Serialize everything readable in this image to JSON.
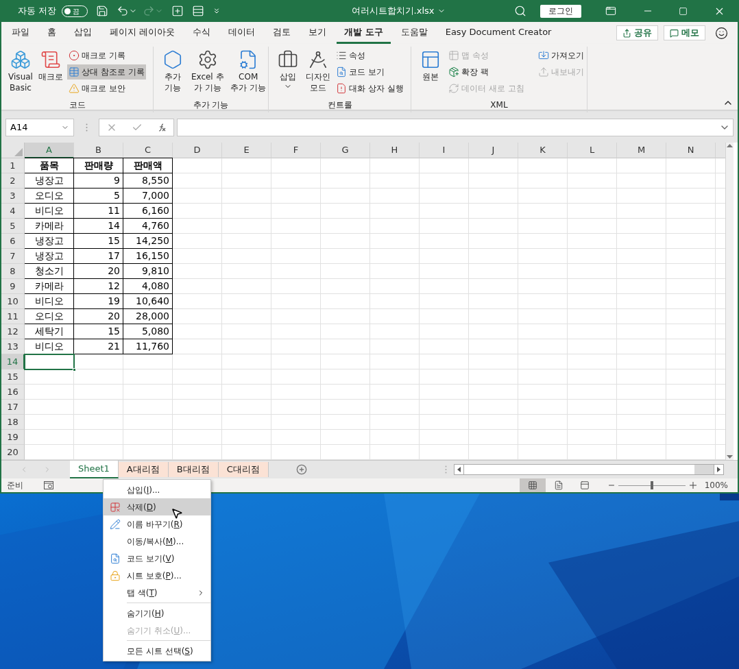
{
  "title_bar": {
    "autosave_label": "자동 저장",
    "autosave_on": false,
    "autosave_state": "끔",
    "document_title": "여러시트합치기.xlsx",
    "login": "로그인"
  },
  "ribbon_tabs": [
    {
      "label": "파일",
      "selected": false
    },
    {
      "label": "홈",
      "selected": false
    },
    {
      "label": "삽입",
      "selected": false
    },
    {
      "label": "페이지 레이아웃",
      "selected": false
    },
    {
      "label": "수식",
      "selected": false
    },
    {
      "label": "데이터",
      "selected": false
    },
    {
      "label": "검토",
      "selected": false
    },
    {
      "label": "보기",
      "selected": false
    },
    {
      "label": "개발 도구",
      "selected": true
    },
    {
      "label": "도움말",
      "selected": false
    },
    {
      "label": "Easy Document Creator",
      "selected": false
    }
  ],
  "share_button": "공유",
  "comments_button": "메모",
  "ribbon_groups": [
    {
      "label": "코드",
      "large": [
        {
          "label": "Visual\nBasic",
          "dropdown": false
        },
        {
          "label": "매크로",
          "dropdown": false
        }
      ],
      "small_columns": [
        [
          {
            "label": "매크로 기록",
            "disabled": false,
            "selected": false
          },
          {
            "label": "상대 참조로 기록",
            "disabled": false,
            "selected": true
          },
          {
            "label": "매크로 보안",
            "disabled": false,
            "selected": false
          }
        ]
      ]
    },
    {
      "label": "추가 기능",
      "large": [
        {
          "label": "추가\n기능",
          "dropdown": false
        },
        {
          "label": "Excel 추\n가 기능",
          "dropdown": false
        },
        {
          "label": "COM\n추가 기능",
          "dropdown": false
        }
      ]
    },
    {
      "label": "컨트롤",
      "large": [
        {
          "label": "삽입",
          "dropdown": true
        },
        {
          "label": "디자인\n모드",
          "dropdown": false
        }
      ],
      "small_columns": [
        [
          {
            "label": "속성",
            "disabled": false,
            "selected": false
          },
          {
            "label": "코드 보기",
            "disabled": false,
            "selected": false
          },
          {
            "label": "대화 상자 실행",
            "disabled": false,
            "selected": false
          }
        ]
      ]
    },
    {
      "label": "XML",
      "large": [
        {
          "label": "원본",
          "dropdown": false
        }
      ],
      "small_columns": [
        [
          {
            "label": "맵 속성",
            "disabled": true,
            "selected": false
          },
          {
            "label": "확장 팩",
            "disabled": false,
            "selected": false
          },
          {
            "label": "데이터 새로 고침",
            "disabled": true,
            "selected": false
          }
        ],
        [
          {
            "label": "가져오기",
            "disabled": false,
            "selected": false
          },
          {
            "label": "내보내기",
            "disabled": true,
            "selected": false
          }
        ]
      ]
    }
  ],
  "name_box": "A14",
  "columns": [
    {
      "label": "A",
      "selected": true
    },
    {
      "label": "B",
      "selected": false
    },
    {
      "label": "C",
      "selected": false
    },
    {
      "label": "D",
      "selected": false
    },
    {
      "label": "E",
      "selected": false
    },
    {
      "label": "F",
      "selected": false
    },
    {
      "label": "G",
      "selected": false
    },
    {
      "label": "H",
      "selected": false
    },
    {
      "label": "I",
      "selected": false
    },
    {
      "label": "J",
      "selected": false
    },
    {
      "label": "K",
      "selected": false
    },
    {
      "label": "L",
      "selected": false
    },
    {
      "label": "M",
      "selected": false
    },
    {
      "label": "N",
      "selected": false
    }
  ],
  "rows": [
    {
      "number": "1",
      "kind": "header",
      "selected": false,
      "cells": [
        "품목",
        "판매량",
        "판매액"
      ]
    },
    {
      "number": "2",
      "kind": "data",
      "selected": false,
      "cells": [
        "냉장고",
        "9",
        "8,550"
      ]
    },
    {
      "number": "3",
      "kind": "data",
      "selected": false,
      "cells": [
        "오디오",
        "5",
        "7,000"
      ]
    },
    {
      "number": "4",
      "kind": "data",
      "selected": false,
      "cells": [
        "비디오",
        "11",
        "6,160"
      ]
    },
    {
      "number": "5",
      "kind": "data",
      "selected": false,
      "cells": [
        "카메라",
        "14",
        "4,760"
      ]
    },
    {
      "number": "6",
      "kind": "data",
      "selected": false,
      "cells": [
        "냉장고",
        "15",
        "14,250"
      ]
    },
    {
      "number": "7",
      "kind": "data",
      "selected": false,
      "cells": [
        "냉장고",
        "17",
        "16,150"
      ]
    },
    {
      "number": "8",
      "kind": "data",
      "selected": false,
      "cells": [
        "청소기",
        "20",
        "9,810"
      ]
    },
    {
      "number": "9",
      "kind": "data",
      "selected": false,
      "cells": [
        "카메라",
        "12",
        "4,080"
      ]
    },
    {
      "number": "10",
      "kind": "data",
      "selected": false,
      "cells": [
        "비디오",
        "19",
        "10,640"
      ]
    },
    {
      "number": "11",
      "kind": "data",
      "selected": false,
      "cells": [
        "오디오",
        "20",
        "28,000"
      ]
    },
    {
      "number": "12",
      "kind": "data",
      "selected": false,
      "cells": [
        "세탁기",
        "15",
        "5,080"
      ]
    },
    {
      "number": "13",
      "kind": "data",
      "selected": false,
      "cells": [
        "비디오",
        "21",
        "11,760"
      ]
    },
    {
      "number": "14",
      "kind": "empty",
      "selected": true,
      "cells": []
    },
    {
      "number": "15",
      "kind": "empty",
      "selected": false,
      "cells": []
    },
    {
      "number": "16",
      "kind": "empty",
      "selected": false,
      "cells": []
    },
    {
      "number": "17",
      "kind": "empty",
      "selected": false,
      "cells": []
    },
    {
      "number": "18",
      "kind": "empty",
      "selected": false,
      "cells": []
    },
    {
      "number": "19",
      "kind": "empty",
      "selected": false,
      "cells": []
    },
    {
      "number": "20",
      "kind": "empty",
      "selected": false,
      "cells": []
    }
  ],
  "sheet_tabs": [
    {
      "label": "Sheet1",
      "selected": true
    },
    {
      "label": "A대리점",
      "selected": false,
      "color": "#fbe2d5"
    },
    {
      "label": "B대리점",
      "selected": false,
      "color": "#fbe2d5"
    },
    {
      "label": "C대리점",
      "selected": false,
      "color": "#fbe2d5"
    }
  ],
  "status_bar": {
    "mode": "준비",
    "zoom": "100%",
    "zoom_level": {
      "level": 0.5
    },
    "views": [
      {
        "selected": true
      },
      {
        "selected": false
      },
      {
        "selected": false
      }
    ]
  },
  "context_menu": [
    {
      "before": "삽입(",
      "key": "I",
      "after": ")...",
      "selected": false,
      "disabled": false,
      "submenu": false,
      "separator_before": false
    },
    {
      "before": "삭제(",
      "key": "D",
      "after": ")",
      "selected": true,
      "disabled": false,
      "submenu": false,
      "separator_before": false
    },
    {
      "before": "이름 바꾸기(",
      "key": "R",
      "after": ")",
      "selected": false,
      "disabled": false,
      "submenu": false,
      "separator_before": false
    },
    {
      "before": "이동/복사(",
      "key": "M",
      "after": ")...",
      "selected": false,
      "disabled": false,
      "submenu": false,
      "separator_before": false
    },
    {
      "before": "코드 보기(",
      "key": "V",
      "after": ")",
      "selected": false,
      "disabled": false,
      "submenu": false,
      "separator_before": false
    },
    {
      "before": "시트 보호(",
      "key": "P",
      "after": ")...",
      "selected": false,
      "disabled": false,
      "submenu": false,
      "separator_before": false
    },
    {
      "before": "탭 색(",
      "key": "T",
      "after": ")",
      "selected": false,
      "disabled": false,
      "submenu": true,
      "separator_before": false
    },
    {
      "before": "숨기기(",
      "key": "H",
      "after": ")",
      "selected": false,
      "disabled": false,
      "submenu": false,
      "separator_before": true
    },
    {
      "before": "숨기기 취소(",
      "key": "U",
      "after": ")...",
      "selected": false,
      "disabled": true,
      "submenu": false,
      "separator_before": false
    },
    {
      "before": "모든 시트 선택(",
      "key": "S",
      "after": ")",
      "selected": false,
      "disabled": false,
      "submenu": false,
      "separator_before": true
    }
  ]
}
